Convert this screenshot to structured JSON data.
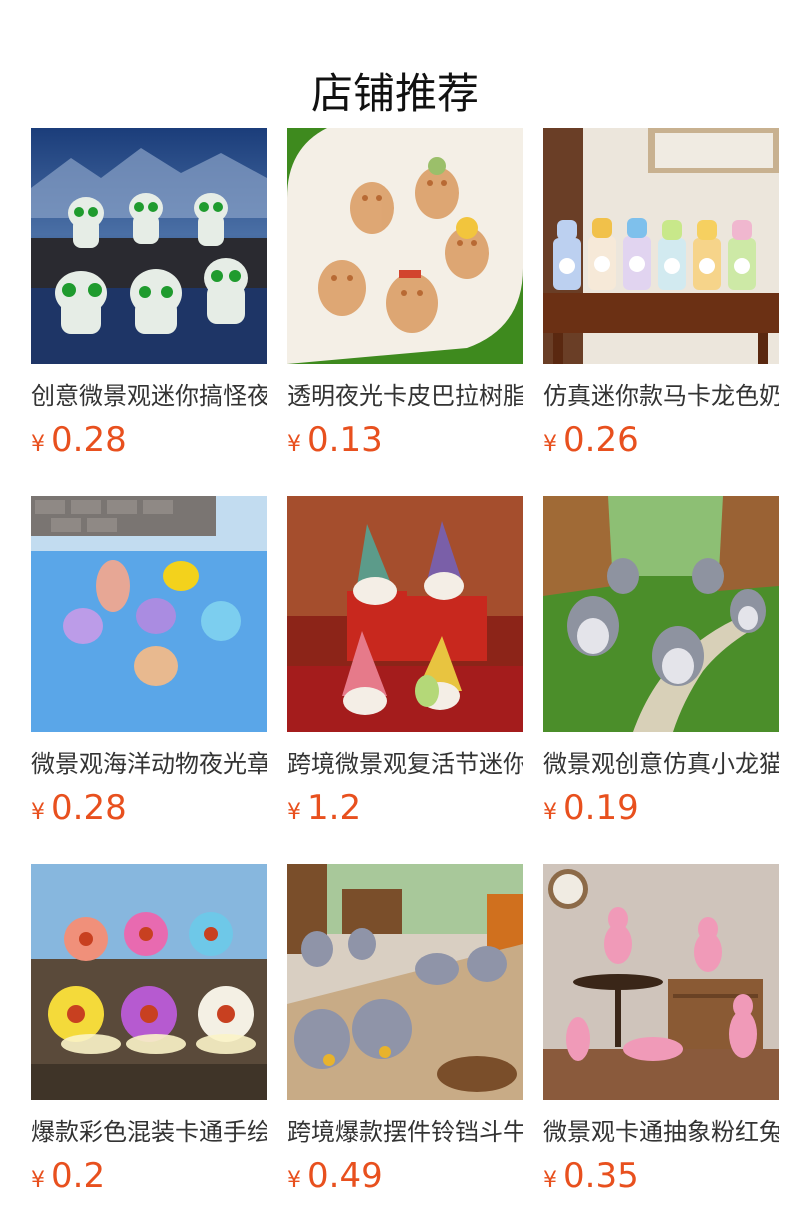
{
  "header": {
    "title": "店铺推荐"
  },
  "currency_symbol": "¥",
  "colors": {
    "price": "#e8501e",
    "title": "#111111",
    "product_text": "#333333"
  },
  "products": [
    {
      "title": "创意微景观迷你搞怪夜光小精灵",
      "price": "0.28"
    },
    {
      "title": "透明夜光卡皮巴拉树脂摆件",
      "price": "0.13"
    },
    {
      "title": "仿真迷你款马卡龙色奶瓶",
      "price": "0.26"
    },
    {
      "title": "微景观海洋动物夜光章鱼",
      "price": "0.28"
    },
    {
      "title": "跨境微景观复活节迷你矮人",
      "price": "1.2"
    },
    {
      "title": "微景观创意仿真小龙猫摆件",
      "price": "0.19"
    },
    {
      "title": "爆款彩色混装卡通手绘蜗牛",
      "price": "0.2"
    },
    {
      "title": "跨境爆款摆件铃铛斗牛犬",
      "price": "0.49"
    },
    {
      "title": "微景观卡通抽象粉红兔子",
      "price": "0.35"
    }
  ]
}
